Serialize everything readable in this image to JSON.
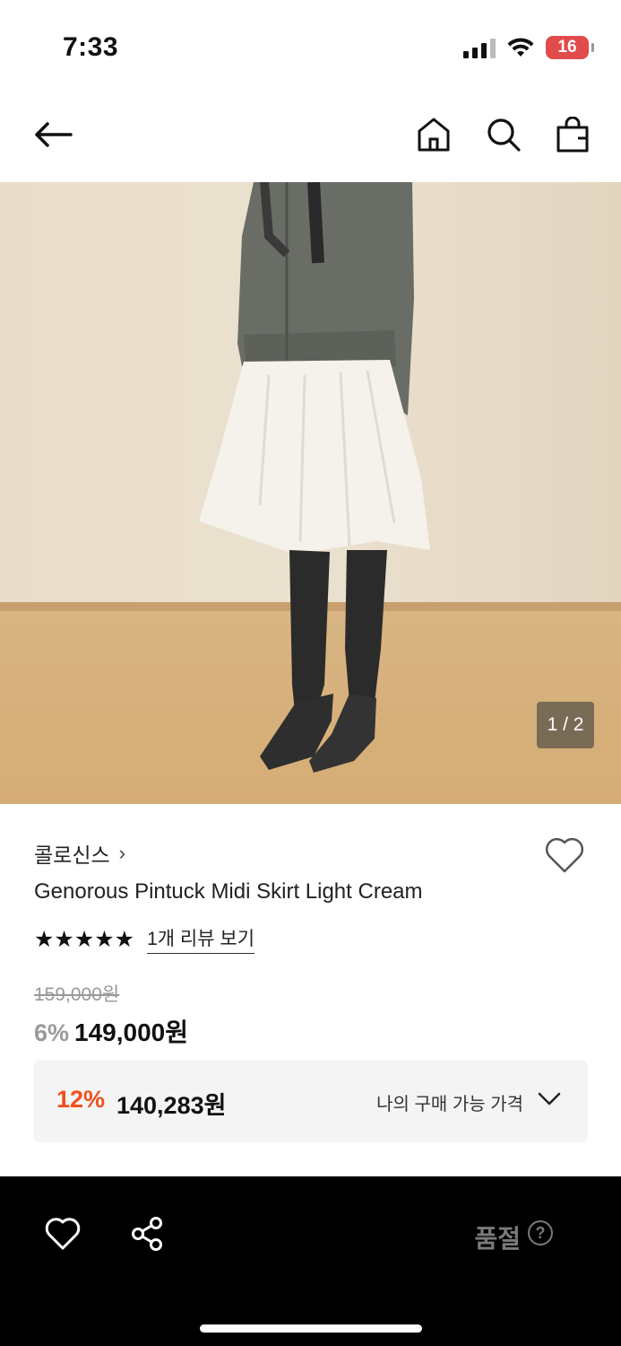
{
  "status_bar": {
    "time": "7:33",
    "battery_level": "16",
    "icons": [
      "signal-icon",
      "wifi-icon",
      "battery-icon"
    ]
  },
  "nav": {
    "icons": [
      "back-arrow-icon",
      "home-icon",
      "search-icon",
      "shopping-bag-icon"
    ]
  },
  "product": {
    "image_counter": "1 / 2",
    "brand": "콜로신스",
    "brand_chevron": "›",
    "title": "Genorous Pintuck Midi Skirt Light Cream",
    "stars": "★★★★★",
    "rating_stars_count": 5,
    "review_link": "1개 리뷰 보기",
    "original_price": "159,000원",
    "discount_rate": "6%",
    "sale_price": "149,000원",
    "my_price": {
      "rate": "12%",
      "price": "140,283원",
      "label": "나의 구매 가능 가격"
    }
  },
  "bottom_bar": {
    "status": "품절",
    "help": "?",
    "icons": [
      "heart-icon",
      "share-icon",
      "help-icon"
    ]
  },
  "colors": {
    "accent_discount": "#f0501e",
    "battery_low": "#e24b4b",
    "bottom_bar_bg": "#000000",
    "soldout_text": "#7a7a7a"
  }
}
